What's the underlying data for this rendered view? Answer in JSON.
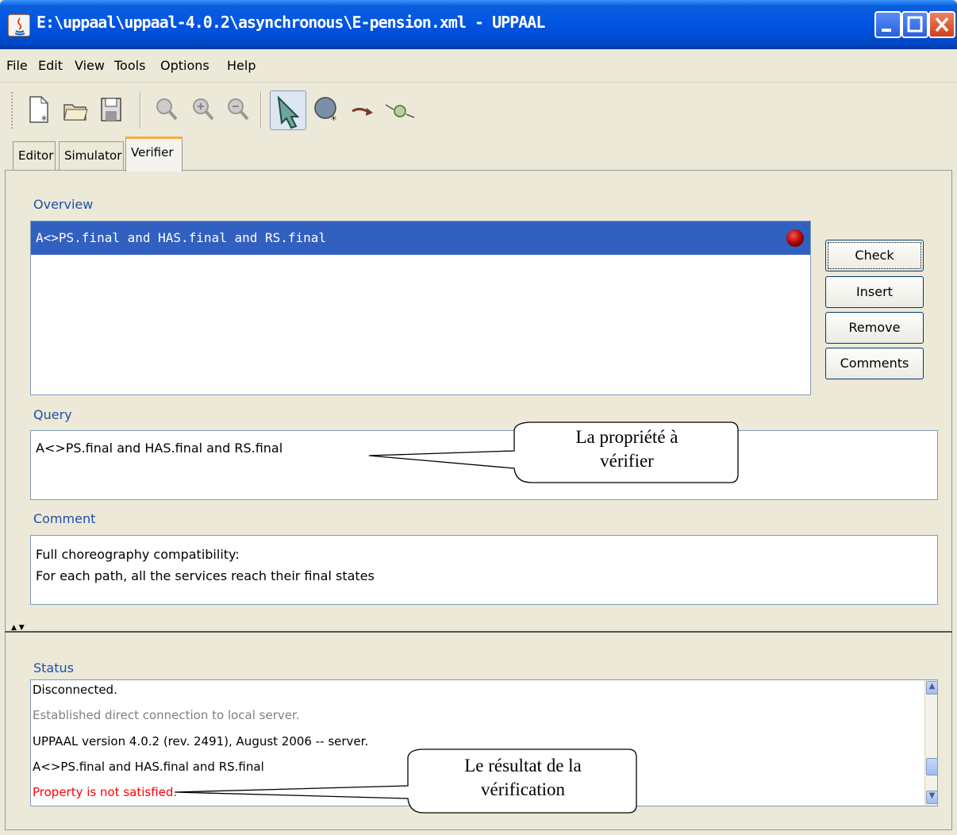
{
  "window": {
    "title": "E:\\uppaal\\uppaal-4.0.2\\asynchronous\\E-pension.xml - UPPAAL",
    "controls": [
      "minimize-icon",
      "maximize-icon",
      "close-icon"
    ]
  },
  "menu": {
    "items": [
      "File",
      "Edit",
      "View",
      "Tools",
      "Options",
      "Help"
    ]
  },
  "toolbar": {
    "icons": [
      "new-document-icon",
      "open-folder-icon",
      "save-icon",
      "zoom-icon",
      "zoom-in-icon",
      "zoom-out-icon",
      "select-arrow-icon",
      "add-location-icon",
      "add-edge-icon",
      "add-nail-icon"
    ]
  },
  "tabs": {
    "items": [
      "Editor",
      "Simulator",
      "Verifier"
    ],
    "active": "Verifier"
  },
  "overview": {
    "label": "Overview",
    "queries": [
      "A<>PS.final and HAS.final and RS.final"
    ]
  },
  "buttons": {
    "check": "Check",
    "insert": "Insert",
    "remove": "Remove",
    "comments": "Comments"
  },
  "query": {
    "label": "Query",
    "value": "A<>PS.final and HAS.final and RS.final"
  },
  "comment": {
    "label": "Comment",
    "line1": "Full choreography compatibility:",
    "line2": "For each path, all the services reach their final states"
  },
  "status": {
    "label": "Status",
    "lines": [
      "Disconnected.",
      "Established direct connection to local server.",
      "UPPAAL version 4.0.2 (rev. 2491), August 2006 -- server.",
      "A<>PS.final and HAS.final and RS.final",
      "Property is not satisfied."
    ]
  },
  "callouts": {
    "property": {
      "line1": "La propriété à",
      "line2": "vérifier"
    },
    "result": {
      "line1": "Le résultat de la",
      "line2": "vérification"
    }
  },
  "colors": {
    "title_bar": "#0054E3",
    "selection": "#3260C0",
    "label": "#1f4fa8",
    "error": "#ff0000",
    "active_tab": "#f4b03a"
  }
}
